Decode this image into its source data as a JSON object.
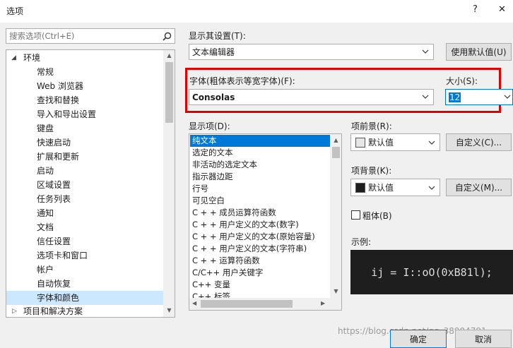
{
  "window": {
    "title": "选项",
    "help": "?",
    "close": "✕"
  },
  "search": {
    "placeholder": "搜索选项(Ctrl+E)"
  },
  "tree": {
    "root": "环境",
    "items": [
      "常规",
      "Web 浏览器",
      "查找和替换",
      "导入和导出设置",
      "键盘",
      "快速启动",
      "扩展和更新",
      "启动",
      "区域设置",
      "任务列表",
      "通知",
      "文档",
      "信任设置",
      "选项卡和窗口",
      "帐户",
      "自动恢复",
      "字体和颜色"
    ],
    "selected": "字体和颜色",
    "next_root": "项目和解决方案"
  },
  "show_settings": {
    "label": "显示其设置(T):",
    "value": "文本编辑器",
    "defaults_button": "使用默认值(U)"
  },
  "font": {
    "label": "字体(粗体表示等宽字体)(F):",
    "value": "Consolas"
  },
  "size": {
    "label": "大小(S):",
    "value": "12"
  },
  "display_items": {
    "label": "显示项(D):",
    "items": [
      "纯文本",
      "选定的文本",
      "非活动的选定文本",
      "指示器边距",
      "行号",
      "可见空白",
      "C + + 成员运算符函数",
      "C + + 用户定义的文本(数字)",
      "C + + 用户定义的文本(原始容量)",
      "C + + 用户定义的文本(字符串)",
      "C + + 运算符函数",
      "C/C++ 用户关键字",
      "C++ 变量",
      "C++ 标签"
    ],
    "selected": "纯文本"
  },
  "foreground": {
    "label": "项前景(R):",
    "value": "默认值",
    "custom_button": "自定义(C)...",
    "swatch": "#e6e6e6"
  },
  "background": {
    "label": "项背景(K):",
    "value": "默认值",
    "custom_button": "自定义(M)...",
    "swatch": "#1e1e1e"
  },
  "bold": {
    "label": "粗体(B)",
    "checked": false
  },
  "sample": {
    "label": "示例:",
    "text": "ij = I::oO(0xB81l);",
    "bg": "#1e1e1e",
    "fg": "#dcdcdc"
  },
  "footer": {
    "ok": "确定",
    "cancel": "取消",
    "watermark": "https://blog.csdn.net/qq_38904791"
  },
  "colors": {
    "highlight_box": "#e00000",
    "selection": "#0078d7"
  }
}
